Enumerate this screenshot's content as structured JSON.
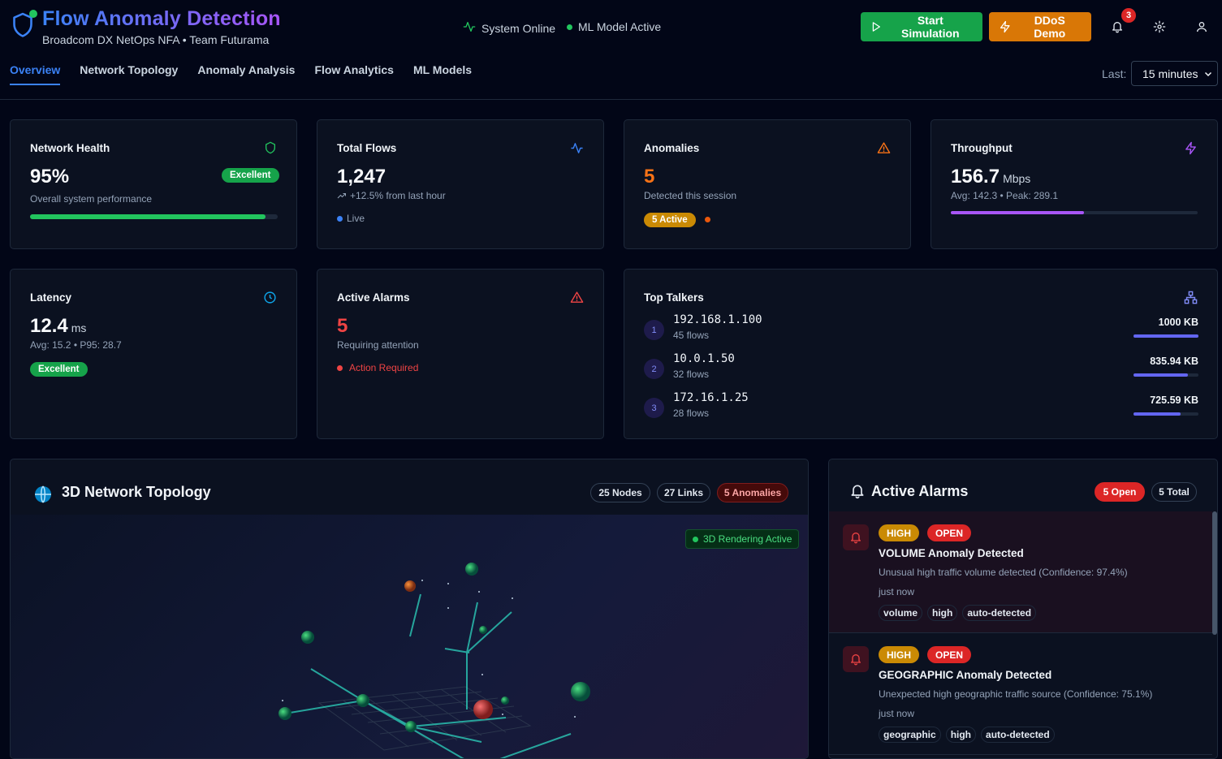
{
  "header": {
    "title": "Flow Anomaly Detection",
    "subtitle": "Broadcom DX NetOps NFA • Team Futurama",
    "status_online": "System Online",
    "status_ml": "ML Model Active",
    "start_button": "Start Simulation",
    "ddos_button": "DDoS Demo",
    "notification_count": "3"
  },
  "tabs": [
    "Overview",
    "Network Topology",
    "Anomaly Analysis",
    "Flow Analytics",
    "ML Models"
  ],
  "time_filter": {
    "label": "Last:",
    "value": "15 minutes"
  },
  "cards": {
    "health": {
      "title": "Network Health",
      "value": "95%",
      "badge": "Excellent",
      "desc": "Overall system performance",
      "progress": 0.95
    },
    "flows": {
      "title": "Total Flows",
      "value": "1,247",
      "trend": "+12.5% from last hour",
      "live": "Live"
    },
    "anomalies": {
      "title": "Anomalies",
      "value": "5",
      "desc": "Detected this session",
      "badge": "5 Active"
    },
    "throughput": {
      "title": "Throughput",
      "value": "156.7",
      "unit": "Mbps",
      "desc": "Avg: 142.3 • Peak: 289.1",
      "progress": 0.54
    },
    "latency": {
      "title": "Latency",
      "value": "12.4",
      "unit": "ms",
      "desc": "Avg: 15.2 • P95: 28.7",
      "badge": "Excellent"
    },
    "alarms": {
      "title": "Active Alarms",
      "value": "5",
      "desc": "Requiring attention",
      "action": "Action Required"
    }
  },
  "top_talkers": {
    "title": "Top Talkers",
    "rows": [
      {
        "rank": "1",
        "ip": "192.168.1.100",
        "flows": "45 flows",
        "kb": "1000 KB",
        "share": 1.0
      },
      {
        "rank": "2",
        "ip": "10.0.1.50",
        "flows": "32 flows",
        "kb": "835.94 KB",
        "share": 0.84
      },
      {
        "rank": "3",
        "ip": "172.16.1.25",
        "flows": "28 flows",
        "kb": "725.59 KB",
        "share": 0.73
      }
    ]
  },
  "topology": {
    "title": "3D Network Topology",
    "nodes": "25 Nodes",
    "links": "27 Links",
    "anomalies": "5 Anomalies",
    "render_status": "3D Rendering Active"
  },
  "active_alarms": {
    "title": "Active Alarms",
    "open": "5 Open",
    "total": "5 Total",
    "items": [
      {
        "severity": "HIGH",
        "state": "OPEN",
        "title": "VOLUME Anomaly Detected",
        "desc": "Unusual high traffic volume detected (Confidence: 97.4%)",
        "time": "just now",
        "tags": [
          "volume",
          "high",
          "auto-detected"
        ]
      },
      {
        "severity": "HIGH",
        "state": "OPEN",
        "title": "GEOGRAPHIC Anomaly Detected",
        "desc": "Unexpected high geographic traffic source (Confidence: 75.1%)",
        "time": "just now",
        "tags": [
          "geographic",
          "high",
          "auto-detected"
        ]
      }
    ]
  },
  "colors": {
    "accent": "#3b82f6",
    "success": "#16a34a",
    "warning": "#d97706",
    "danger": "#dc2626",
    "purple": "#a855f7"
  }
}
